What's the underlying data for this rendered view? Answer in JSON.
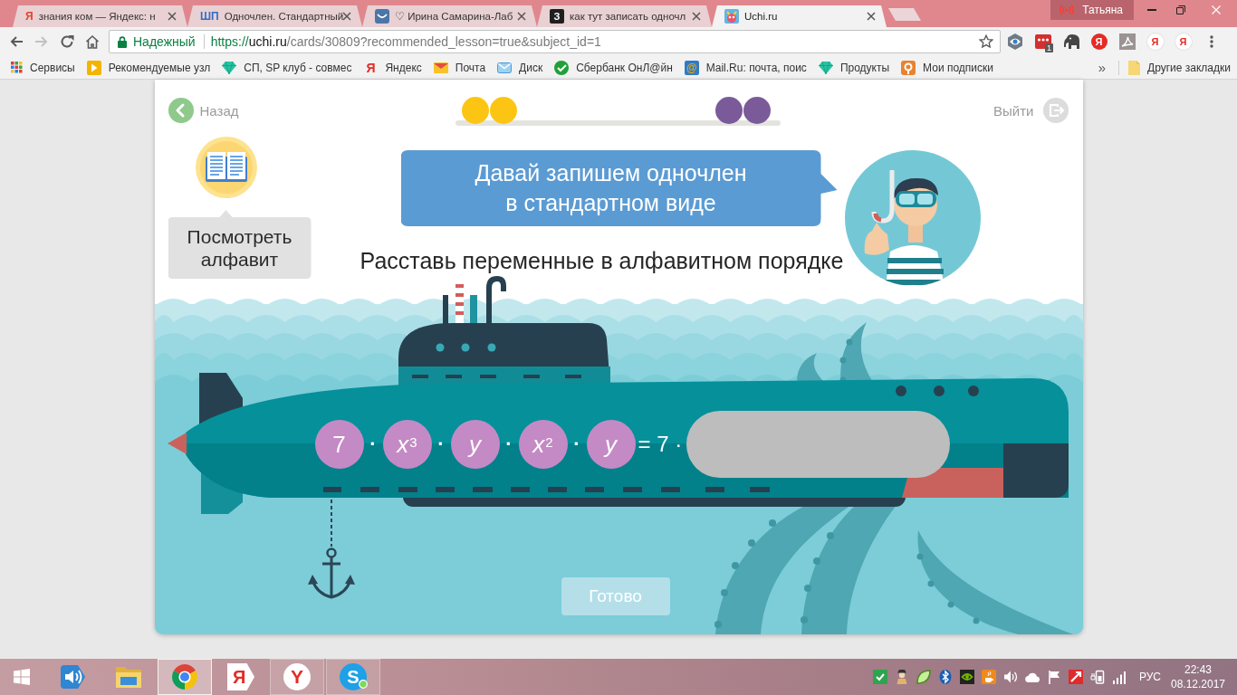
{
  "browser": {
    "tabs": [
      {
        "title": "знания ком — Яндекс: н",
        "kind": "letter",
        "favicon": "Я",
        "color": "#e8412c",
        "selected": false
      },
      {
        "title": "Одночлен. Стандартный",
        "kind": "letter",
        "favicon": "ШП",
        "color": "#2f6fc6",
        "selected": false
      },
      {
        "title": "♡ Ирина Самарина-Лаб",
        "kind": "vk",
        "selected": false
      },
      {
        "title": "как тут записать одночл",
        "kind": "tile",
        "favicon": "З",
        "color": "#1f1f1f",
        "selected": false
      },
      {
        "title": "Uchi.ru",
        "kind": "picture",
        "selected": true
      }
    ],
    "profile": {
      "name": "Татьяна"
    },
    "nav": [
      {
        "kind": "back",
        "disabled": false
      },
      {
        "kind": "forward",
        "disabled": true
      },
      {
        "kind": "reload",
        "disabled": false
      },
      {
        "kind": "home",
        "disabled": false
      }
    ],
    "omnibox": {
      "security": "Надежный",
      "url": {
        "scheme": "https://",
        "host": "uchi.ru",
        "path": "/cards/30809?recommended_lesson=true&subject_id=1"
      }
    },
    "extensions": [
      {
        "kind": "eye"
      },
      {
        "kind": "dots",
        "badge": "1"
      },
      {
        "kind": "elephant"
      },
      {
        "kind": "solid",
        "text": "Я"
      },
      {
        "kind": "curve"
      },
      {
        "kind": "plain",
        "text": "Я"
      },
      {
        "kind": "plain",
        "text": "Я"
      }
    ],
    "bookmarks": [
      {
        "label": "Сервисы",
        "kind": "apps"
      },
      {
        "label": "Рекомендуемые узл",
        "kind": "bing"
      },
      {
        "label": "СП, SP клуб - совмес",
        "kind": "gem"
      },
      {
        "label": "Яндекс",
        "kind": "letter",
        "icon_text": "Я"
      },
      {
        "label": "Почта",
        "kind": "mail"
      },
      {
        "label": "Диск",
        "kind": "disk"
      },
      {
        "label": "Сбербанк ОнЛ@йн",
        "kind": "sber"
      },
      {
        "label": "Mail.Ru: почта, поис",
        "kind": "at",
        "icon_text": "@"
      },
      {
        "label": "Продукты",
        "kind": "gem"
      },
      {
        "label": "Мои подписки",
        "kind": "subs"
      }
    ],
    "bookmarks_overflow": "»",
    "other_bookmarks": "Другие закладки"
  },
  "lesson": {
    "back": "Назад",
    "progress": {
      "start_dots": [
        {
          "color": "#fdc513"
        },
        {
          "color": "#fdc513"
        }
      ],
      "end_dots": [
        {
          "color": "#7b5a99"
        },
        {
          "color": "#7b5a99"
        }
      ]
    },
    "exit": "Выйти",
    "alphabet_button": "Посмотреть\nалфавит",
    "speech": "Давай запишем одночлен\nв стандартном виде",
    "instruction": "Расставь переменные в алфавитном порядке",
    "expression": [
      {
        "kind": "number",
        "text": "7"
      },
      {
        "kind": "op",
        "text": "·"
      },
      {
        "kind": "power",
        "text": "*x*$^{3}$"
      },
      {
        "kind": "op",
        "text": "·"
      },
      {
        "kind": "variable",
        "text": "y"
      },
      {
        "kind": "op",
        "text": "·"
      },
      {
        "kind": "power",
        "text": "*x*$^{2}$"
      },
      {
        "kind": "op",
        "text": "·"
      },
      {
        "kind": "variable",
        "text": "y"
      },
      {
        "kind": "text",
        "text": "= 7 ·"
      },
      {
        "kind": "blank"
      }
    ],
    "done_button": {
      "label": "Готово",
      "disabled": true
    }
  },
  "taskbar": {
    "apps": [
      {
        "kind": "speaker",
        "open": false,
        "selected": false
      },
      {
        "kind": "folder",
        "open": false,
        "selected": false
      },
      {
        "kind": "ring",
        "open": true,
        "selected": true
      },
      {
        "kind": "tag",
        "icon_text": "Я",
        "open": false,
        "selected": false
      },
      {
        "kind": "circle",
        "icon_text": "Y",
        "open": true,
        "selected": false
      },
      {
        "kind": "bubble",
        "icon_text": "S",
        "open": true,
        "selected": false
      }
    ],
    "tray": [
      {
        "kind": "check"
      },
      {
        "kind": "figure"
      },
      {
        "kind": "leaf"
      },
      {
        "kind": "bluetooth"
      },
      {
        "kind": "swirl"
      },
      {
        "kind": "cup"
      },
      {
        "kind": "speaker"
      },
      {
        "kind": "cloud"
      },
      {
        "kind": "flag"
      },
      {
        "kind": "slash"
      },
      {
        "kind": "battery"
      },
      {
        "kind": "signal"
      }
    ],
    "language": "РУС",
    "time": "22:43",
    "date": "08.12.2017"
  }
}
